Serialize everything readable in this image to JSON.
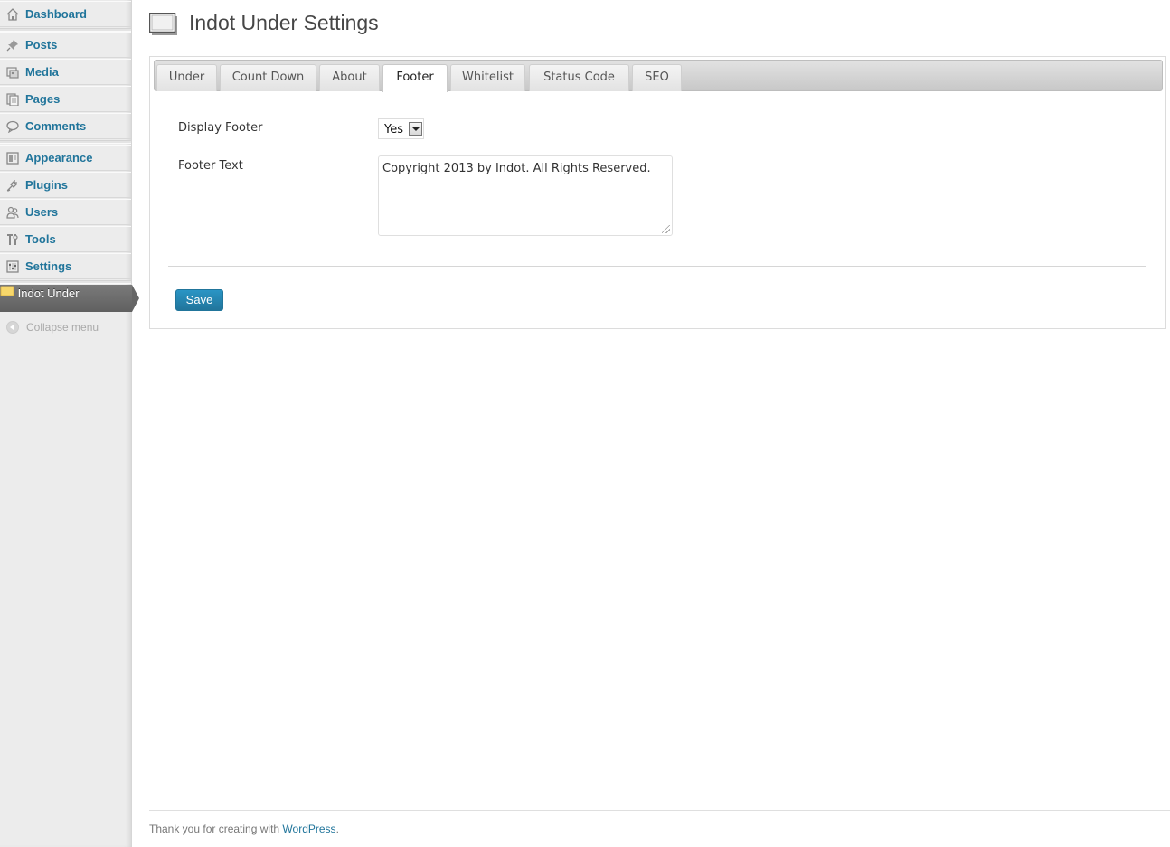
{
  "sidebar": {
    "items": [
      {
        "label": "Dashboard",
        "icon": "dashboard-icon"
      },
      {
        "label": "Posts",
        "icon": "pushpin-icon"
      },
      {
        "label": "Media",
        "icon": "media-icon"
      },
      {
        "label": "Pages",
        "icon": "pages-icon"
      },
      {
        "label": "Comments",
        "icon": "comments-icon"
      },
      {
        "label": "Appearance",
        "icon": "appearance-icon"
      },
      {
        "label": "Plugins",
        "icon": "plugin-icon"
      },
      {
        "label": "Users",
        "icon": "users-icon"
      },
      {
        "label": "Tools",
        "icon": "tools-icon"
      },
      {
        "label": "Settings",
        "icon": "settings-icon"
      }
    ],
    "active_item": {
      "label": "Indot Under",
      "icon": "indot-under-icon"
    },
    "collapse_label": "Collapse menu"
  },
  "header": {
    "title": "Indot Under Settings"
  },
  "tabs": [
    {
      "label": "Under"
    },
    {
      "label": "Count Down"
    },
    {
      "label": "About"
    },
    {
      "label": "Footer",
      "active": true
    },
    {
      "label": "Whitelist"
    },
    {
      "label": "Status Code"
    },
    {
      "label": "SEO"
    }
  ],
  "form": {
    "display_footer": {
      "label": "Display Footer",
      "value": "Yes"
    },
    "footer_text": {
      "label": "Footer Text",
      "value": "Copyright 2013 by Indot. All Rights Reserved."
    },
    "save_label": "Save"
  },
  "footer": {
    "text": "Thank you for creating with",
    "link": "WordPress",
    "suffix": "."
  },
  "colors": {
    "link": "#21759b",
    "primary_button": "#21759b",
    "active_menu": "#6d6d6d"
  }
}
